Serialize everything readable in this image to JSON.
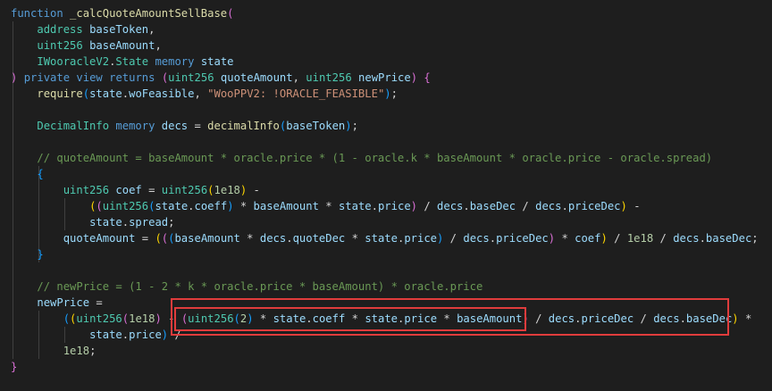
{
  "editor": {
    "language": "solidity",
    "colors": {
      "background": "#1e1e1e",
      "keyword": "#569cd6",
      "function": "#dcdcaa",
      "type": "#4ec9b0",
      "variable": "#9cdcfe",
      "string": "#ce9178",
      "number": "#b5cea8",
      "comment": "#6a9955",
      "highlight_border": "#e03c3c"
    },
    "lines": [
      [
        [
          "kw",
          "function"
        ],
        [
          "p",
          " "
        ],
        [
          "fn",
          "_calcQuoteAmountSellBase"
        ],
        [
          "b2",
          "("
        ]
      ],
      [
        [
          "p",
          "    "
        ],
        [
          "ty",
          "address"
        ],
        [
          "p",
          " "
        ],
        [
          "var",
          "baseToken"
        ],
        [
          "p",
          ","
        ]
      ],
      [
        [
          "p",
          "    "
        ],
        [
          "ty",
          "uint256"
        ],
        [
          "p",
          " "
        ],
        [
          "var",
          "baseAmount"
        ],
        [
          "p",
          ","
        ]
      ],
      [
        [
          "p",
          "    "
        ],
        [
          "ty",
          "IWooracleV2"
        ],
        [
          "p",
          "."
        ],
        [
          "ty",
          "State"
        ],
        [
          "p",
          " "
        ],
        [
          "kw",
          "memory"
        ],
        [
          "p",
          " "
        ],
        [
          "var",
          "state"
        ]
      ],
      [
        [
          "b2",
          ")"
        ],
        [
          "p",
          " "
        ],
        [
          "kw",
          "private"
        ],
        [
          "p",
          " "
        ],
        [
          "kw",
          "view"
        ],
        [
          "p",
          " "
        ],
        [
          "kw",
          "returns"
        ],
        [
          "p",
          " "
        ],
        [
          "b2",
          "("
        ],
        [
          "ty",
          "uint256"
        ],
        [
          "p",
          " "
        ],
        [
          "var",
          "quoteAmount"
        ],
        [
          "p",
          ", "
        ],
        [
          "ty",
          "uint256"
        ],
        [
          "p",
          " "
        ],
        [
          "var",
          "newPrice"
        ],
        [
          "b2",
          ")"
        ],
        [
          "p",
          " "
        ],
        [
          "b2",
          "{"
        ]
      ],
      [
        [
          "p",
          "    "
        ],
        [
          "fn",
          "require"
        ],
        [
          "b3",
          "("
        ],
        [
          "var",
          "state"
        ],
        [
          "p",
          "."
        ],
        [
          "var",
          "woFeasible"
        ],
        [
          "p",
          ", "
        ],
        [
          "str",
          "\"WooPPV2: !ORACLE_FEASIBLE\""
        ],
        [
          "b3",
          ")"
        ],
        [
          "p",
          ";"
        ]
      ],
      [],
      [
        [
          "p",
          "    "
        ],
        [
          "ty",
          "DecimalInfo"
        ],
        [
          "p",
          " "
        ],
        [
          "kw",
          "memory"
        ],
        [
          "p",
          " "
        ],
        [
          "var",
          "decs"
        ],
        [
          "p",
          " = "
        ],
        [
          "fn",
          "decimalInfo"
        ],
        [
          "b3",
          "("
        ],
        [
          "var",
          "baseToken"
        ],
        [
          "b3",
          ")"
        ],
        [
          "p",
          ";"
        ]
      ],
      [],
      [
        [
          "p",
          "    "
        ],
        [
          "com",
          "// quoteAmount = baseAmount * oracle.price * (1 - oracle.k * baseAmount * oracle.price - oracle.spread)"
        ]
      ],
      [
        [
          "p",
          "    "
        ],
        [
          "b3",
          "{"
        ]
      ],
      [
        [
          "p",
          "        "
        ],
        [
          "ty",
          "uint256"
        ],
        [
          "p",
          " "
        ],
        [
          "var",
          "coef"
        ],
        [
          "p",
          " = "
        ],
        [
          "ty",
          "uint256"
        ],
        [
          "b1",
          "("
        ],
        [
          "num",
          "1e18"
        ],
        [
          "b1",
          ")"
        ],
        [
          "p",
          " -"
        ]
      ],
      [
        [
          "p",
          "            "
        ],
        [
          "b1",
          "("
        ],
        [
          "b2",
          "("
        ],
        [
          "ty",
          "uint256"
        ],
        [
          "b3",
          "("
        ],
        [
          "var",
          "state"
        ],
        [
          "p",
          "."
        ],
        [
          "var",
          "coeff"
        ],
        [
          "b3",
          ")"
        ],
        [
          "p",
          " * "
        ],
        [
          "var",
          "baseAmount"
        ],
        [
          "p",
          " * "
        ],
        [
          "var",
          "state"
        ],
        [
          "p",
          "."
        ],
        [
          "var",
          "price"
        ],
        [
          "b2",
          ")"
        ],
        [
          "p",
          " / "
        ],
        [
          "var",
          "decs"
        ],
        [
          "p",
          "."
        ],
        [
          "var",
          "baseDec"
        ],
        [
          "p",
          " / "
        ],
        [
          "var",
          "decs"
        ],
        [
          "p",
          "."
        ],
        [
          "var",
          "priceDec"
        ],
        [
          "b1",
          ")"
        ],
        [
          "p",
          " -"
        ]
      ],
      [
        [
          "p",
          "            "
        ],
        [
          "var",
          "state"
        ],
        [
          "p",
          "."
        ],
        [
          "var",
          "spread"
        ],
        [
          "p",
          ";"
        ]
      ],
      [
        [
          "p",
          "        "
        ],
        [
          "var",
          "quoteAmount"
        ],
        [
          "p",
          " = "
        ],
        [
          "b1",
          "("
        ],
        [
          "b2",
          "("
        ],
        [
          "b3",
          "("
        ],
        [
          "var",
          "baseAmount"
        ],
        [
          "p",
          " * "
        ],
        [
          "var",
          "decs"
        ],
        [
          "p",
          "."
        ],
        [
          "var",
          "quoteDec"
        ],
        [
          "p",
          " * "
        ],
        [
          "var",
          "state"
        ],
        [
          "p",
          "."
        ],
        [
          "var",
          "price"
        ],
        [
          "b3",
          ")"
        ],
        [
          "p",
          " / "
        ],
        [
          "var",
          "decs"
        ],
        [
          "p",
          "."
        ],
        [
          "var",
          "priceDec"
        ],
        [
          "b2",
          ")"
        ],
        [
          "p",
          " * "
        ],
        [
          "var",
          "coef"
        ],
        [
          "b1",
          ")"
        ],
        [
          "p",
          " / "
        ],
        [
          "num",
          "1e18"
        ],
        [
          "p",
          " / "
        ],
        [
          "var",
          "decs"
        ],
        [
          "p",
          "."
        ],
        [
          "var",
          "baseDec"
        ],
        [
          "p",
          ";"
        ]
      ],
      [
        [
          "p",
          "    "
        ],
        [
          "b3",
          "}"
        ]
      ],
      [],
      [
        [
          "p",
          "    "
        ],
        [
          "com",
          "// newPrice = (1 - 2 * k * oracle.price * baseAmount) * oracle.price"
        ]
      ],
      [
        [
          "p",
          "    "
        ],
        [
          "var",
          "newPrice"
        ],
        [
          "p",
          " ="
        ]
      ],
      [
        [
          "p",
          "        "
        ],
        [
          "b3",
          "("
        ],
        [
          "b1",
          "("
        ],
        [
          "ty",
          "uint256"
        ],
        [
          "b2",
          "("
        ],
        [
          "num",
          "1e18"
        ],
        [
          "b2",
          ")"
        ],
        [
          "p",
          " - "
        ],
        [
          "b2",
          "("
        ],
        [
          "ty",
          "uint256"
        ],
        [
          "b3",
          "("
        ],
        [
          "num",
          "2"
        ],
        [
          "b3",
          ")"
        ],
        [
          "p",
          " * "
        ],
        [
          "var",
          "state"
        ],
        [
          "p",
          "."
        ],
        [
          "var",
          "coeff"
        ],
        [
          "p",
          " * "
        ],
        [
          "var",
          "state"
        ],
        [
          "p",
          "."
        ],
        [
          "var",
          "price"
        ],
        [
          "p",
          " * "
        ],
        [
          "var",
          "baseAmount"
        ],
        [
          "b2",
          ")"
        ],
        [
          "p",
          " / "
        ],
        [
          "var",
          "decs"
        ],
        [
          "p",
          "."
        ],
        [
          "var",
          "priceDec"
        ],
        [
          "p",
          " / "
        ],
        [
          "var",
          "decs"
        ],
        [
          "p",
          "."
        ],
        [
          "var",
          "baseDec"
        ],
        [
          "b1",
          ")"
        ],
        [
          "p",
          " *"
        ]
      ],
      [
        [
          "p",
          "            "
        ],
        [
          "var",
          "state"
        ],
        [
          "p",
          "."
        ],
        [
          "var",
          "price"
        ],
        [
          "b3",
          ")"
        ],
        [
          "p",
          " /"
        ]
      ],
      [
        [
          "p",
          "        "
        ],
        [
          "num",
          "1e18"
        ],
        [
          "p",
          ";"
        ]
      ],
      [
        [
          "b2",
          "}"
        ]
      ]
    ]
  }
}
